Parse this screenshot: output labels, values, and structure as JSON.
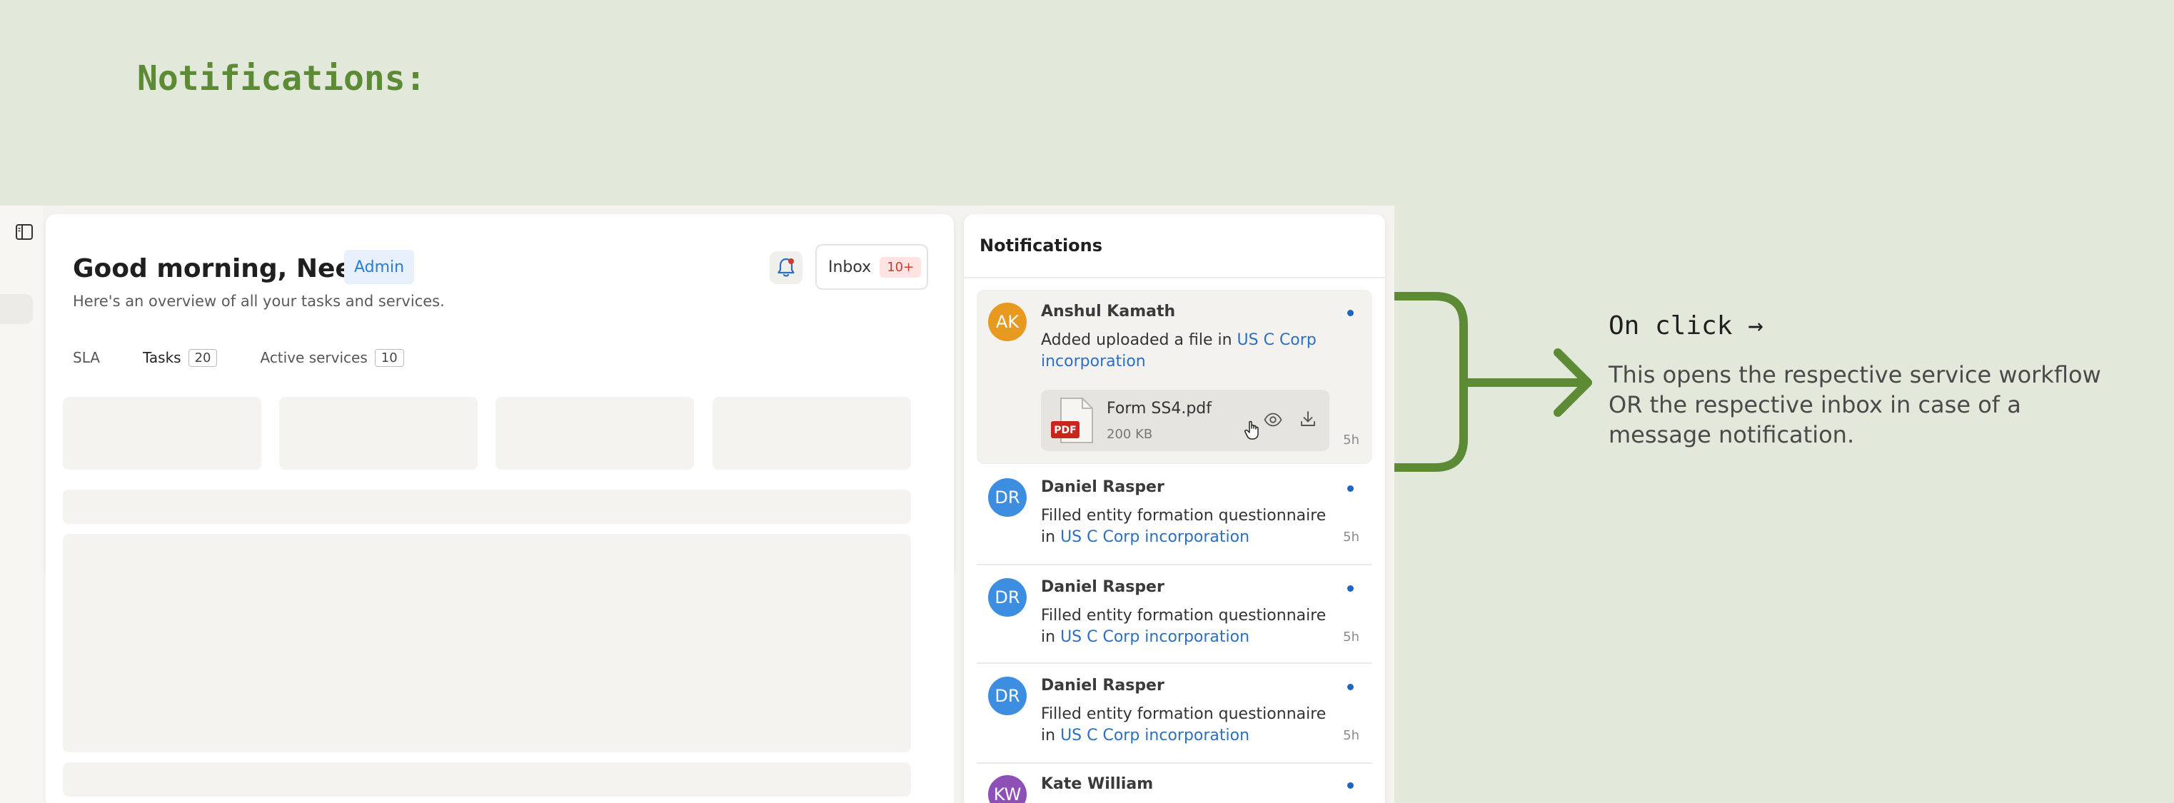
{
  "page": {
    "heading": "Notifications:",
    "annotation": {
      "title": "On click →",
      "description": "This opens the respective service workflow OR the respective inbox in case of a message notification."
    }
  },
  "dashboard": {
    "greeting": "Good morning, Neeti",
    "role_badge": "Admin",
    "subtitle": "Here's an overview of all your tasks and services.",
    "inbox": {
      "label": "Inbox",
      "count": "10+"
    },
    "tabs": [
      {
        "label": "SLA",
        "count": ""
      },
      {
        "label": "Tasks",
        "count": "20",
        "active": true
      },
      {
        "label": "Active services",
        "count": "10"
      }
    ]
  },
  "notifications": {
    "title": "Notifications",
    "items": [
      {
        "initials": "AK",
        "avatar_color": "#e79a1f",
        "name": "Anshul Kamath",
        "text": "Added uploaded a file in ",
        "link": "US C Corp incorporation",
        "time": "5h",
        "file": {
          "name": "Form SS4.pdf",
          "size": "200 KB",
          "type": "PDF"
        }
      },
      {
        "initials": "DR",
        "avatar_color": "#3d8ee0",
        "name": "Daniel Rasper",
        "text": "Filled entity formation questionnaire in ",
        "link": "US C Corp incorporation",
        "time": "5h"
      },
      {
        "initials": "DR",
        "avatar_color": "#3d8ee0",
        "name": "Daniel Rasper",
        "text": "Filled entity formation questionnaire in ",
        "link": "US C Corp incorporation",
        "time": "5h"
      },
      {
        "initials": "DR",
        "avatar_color": "#3d8ee0",
        "name": "Daniel Rasper",
        "text": "Filled entity formation questionnaire in ",
        "link": "US C Corp incorporation",
        "time": "5h"
      },
      {
        "initials": "KW",
        "avatar_color": "#8e4fb6",
        "name": "Kate William"
      }
    ]
  },
  "colors": {
    "accent_green": "#5d8a34",
    "link_blue": "#2a6fc4",
    "unread_dot": "#1e66c2"
  }
}
